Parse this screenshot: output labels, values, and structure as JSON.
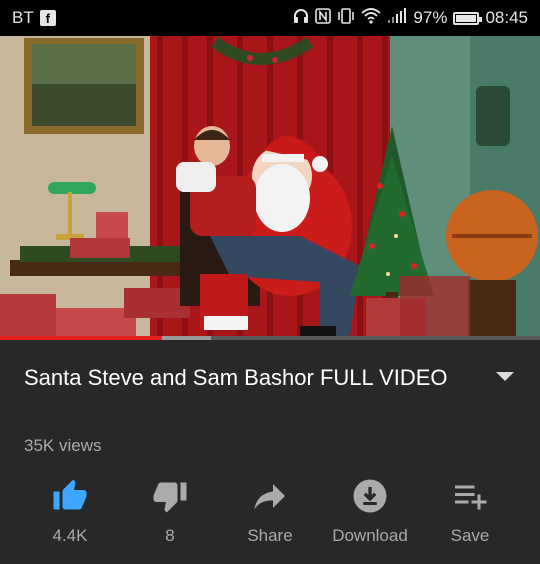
{
  "status_bar": {
    "carrier": "BT",
    "battery": "97%",
    "time": "08:45"
  },
  "video": {
    "progress_played": 0.3,
    "progress_buffered_end": 0.39
  },
  "video_info": {
    "title": "Santa Steve and Sam Bashor FULL VIDEO",
    "views": "35K views"
  },
  "actions": {
    "like": {
      "label": "4.4K",
      "icon": "thumbs-up-icon",
      "color": "#3ea6ff"
    },
    "dislike": {
      "label": "8",
      "icon": "thumbs-down-icon"
    },
    "share": {
      "label": "Share",
      "icon": "share-icon"
    },
    "download": {
      "label": "Download",
      "icon": "download-icon"
    },
    "save": {
      "label": "Save",
      "icon": "playlist-add-icon"
    }
  }
}
